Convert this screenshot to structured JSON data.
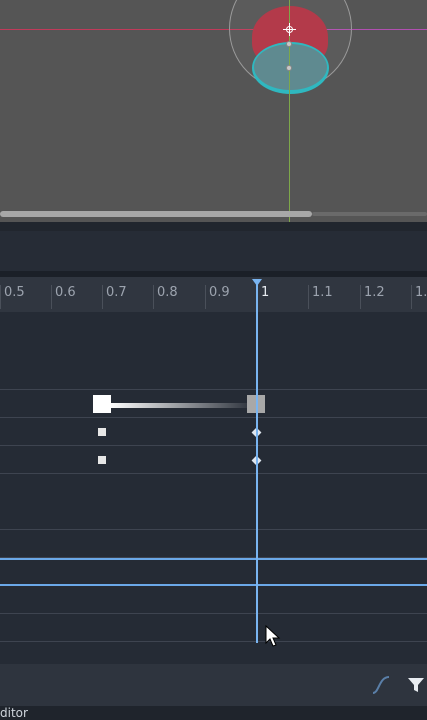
{
  "ruler": {
    "ticks": [
      "0.5",
      "0.6",
      "0.7",
      "0.8",
      "0.9",
      "1",
      "1.1",
      "1.2",
      "1."
    ]
  },
  "bottom_bar": {
    "curve_icon": "bezier-curve-icon",
    "filter_icon": "filter-icon"
  },
  "status": {
    "text": "ditor"
  },
  "colors": {
    "viewport_bg": "#555555",
    "timeline_bg": "#252b35",
    "playhead": "#79b4f0",
    "x_axis": "#c03a5a",
    "y_axis": "#7ea84a",
    "shape_red": "#b33a4a",
    "shape_teal": "#2fb8c0"
  }
}
